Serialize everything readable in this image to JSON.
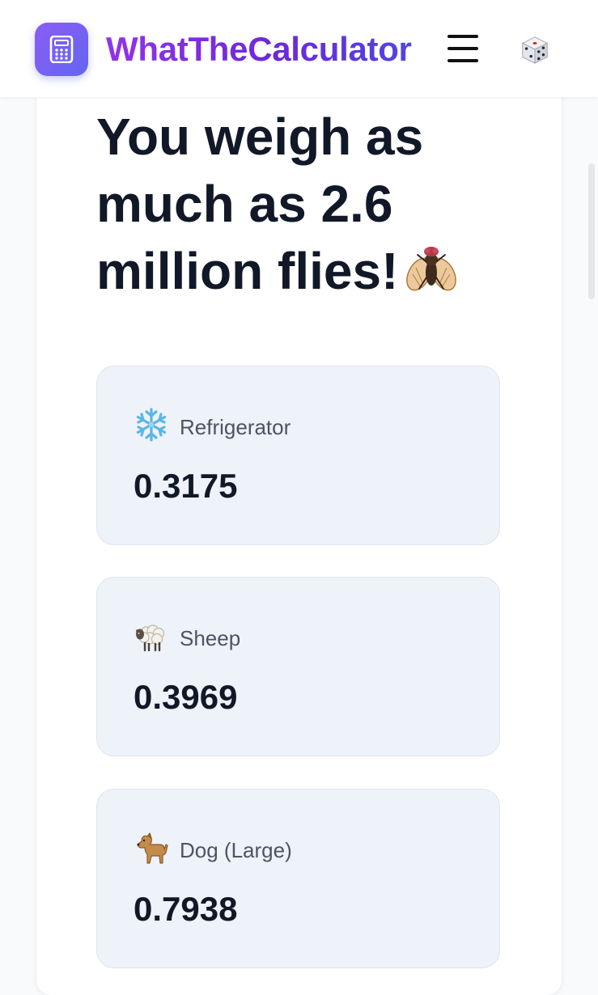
{
  "header": {
    "brand": "WhatTheCalculator",
    "logo_icon": "calculator-icon",
    "menu_icon": "hamburger-menu-icon",
    "random_icon": "dice-icon"
  },
  "result": {
    "prefix": "You weigh as much as 2.6 million flies!",
    "icon": "fly-icon"
  },
  "comparisons": [
    {
      "icon": "snowflake-icon",
      "label": "Refrigerator",
      "value": "0.3175"
    },
    {
      "icon": "sheep-icon",
      "label": "Sheep",
      "value": "0.3969"
    },
    {
      "icon": "dog-icon",
      "label": "Dog (Large)",
      "value": "0.7938"
    }
  ],
  "colors": {
    "brand_gradient_start": "#9333ea",
    "brand_gradient_end": "#4f46e5",
    "card_bg": "#eef2f9",
    "text_dark": "#111827",
    "text_muted": "#4b5563"
  }
}
